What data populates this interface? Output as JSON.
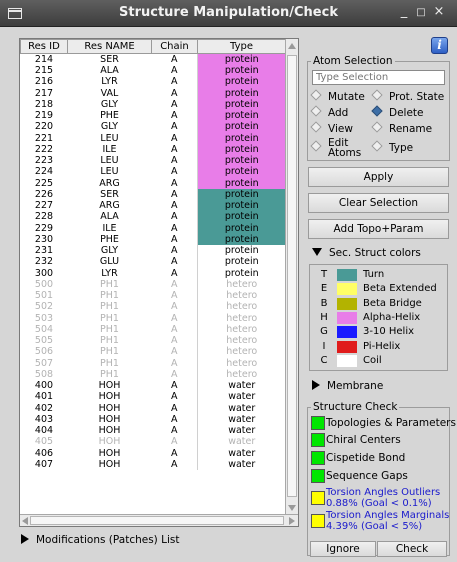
{
  "window": {
    "title": "Structure Manipulation/Check",
    "minimize_glyph": "_",
    "maximize_glyph": "□",
    "close_glyph": "×"
  },
  "table": {
    "columns": [
      "Res ID",
      "Res NAME",
      "Chain",
      "Type"
    ],
    "rows": [
      {
        "id": "214",
        "name": "SER",
        "chain": "A",
        "type": "protein",
        "color": "#e87de8"
      },
      {
        "id": "215",
        "name": "ALA",
        "chain": "A",
        "type": "protein",
        "color": "#e87de8"
      },
      {
        "id": "216",
        "name": "LYR",
        "chain": "A",
        "type": "protein",
        "color": "#e87de8"
      },
      {
        "id": "217",
        "name": "VAL",
        "chain": "A",
        "type": "protein",
        "color": "#e87de8"
      },
      {
        "id": "218",
        "name": "GLY",
        "chain": "A",
        "type": "protein",
        "color": "#e87de8"
      },
      {
        "id": "219",
        "name": "PHE",
        "chain": "A",
        "type": "protein",
        "color": "#e87de8"
      },
      {
        "id": "220",
        "name": "GLY",
        "chain": "A",
        "type": "protein",
        "color": "#e87de8"
      },
      {
        "id": "221",
        "name": "LEU",
        "chain": "A",
        "type": "protein",
        "color": "#e87de8"
      },
      {
        "id": "222",
        "name": "ILE",
        "chain": "A",
        "type": "protein",
        "color": "#e87de8"
      },
      {
        "id": "223",
        "name": "LEU",
        "chain": "A",
        "type": "protein",
        "color": "#e87de8"
      },
      {
        "id": "224",
        "name": "LEU",
        "chain": "A",
        "type": "protein",
        "color": "#e87de8"
      },
      {
        "id": "225",
        "name": "ARG",
        "chain": "A",
        "type": "protein",
        "color": "#e87de8"
      },
      {
        "id": "226",
        "name": "SER",
        "chain": "A",
        "type": "protein",
        "color": "#4a9a96"
      },
      {
        "id": "227",
        "name": "ARG",
        "chain": "A",
        "type": "protein",
        "color": "#4a9a96"
      },
      {
        "id": "228",
        "name": "ALA",
        "chain": "A",
        "type": "protein",
        "color": "#4a9a96"
      },
      {
        "id": "229",
        "name": "ILE",
        "chain": "A",
        "type": "protein",
        "color": "#4a9a96"
      },
      {
        "id": "230",
        "name": "PHE",
        "chain": "A",
        "type": "protein",
        "color": "#4a9a96"
      },
      {
        "id": "231",
        "name": "GLY",
        "chain": "A",
        "type": "protein",
        "color": "#ffffff"
      },
      {
        "id": "232",
        "name": "GLU",
        "chain": "A",
        "type": "protein",
        "color": "#ffffff"
      },
      {
        "id": "300",
        "name": "LYR",
        "chain": "A",
        "type": "protein",
        "color": "#ffffff"
      },
      {
        "id": "500",
        "name": "PH1",
        "chain": "A",
        "type": "hetero",
        "faded": true
      },
      {
        "id": "501",
        "name": "PH1",
        "chain": "A",
        "type": "hetero",
        "faded": true
      },
      {
        "id": "502",
        "name": "PH1",
        "chain": "A",
        "type": "hetero",
        "faded": true
      },
      {
        "id": "503",
        "name": "PH1",
        "chain": "A",
        "type": "hetero",
        "faded": true
      },
      {
        "id": "504",
        "name": "PH1",
        "chain": "A",
        "type": "hetero",
        "faded": true
      },
      {
        "id": "505",
        "name": "PH1",
        "chain": "A",
        "type": "hetero",
        "faded": true
      },
      {
        "id": "506",
        "name": "PH1",
        "chain": "A",
        "type": "hetero",
        "faded": true
      },
      {
        "id": "507",
        "name": "PH1",
        "chain": "A",
        "type": "hetero",
        "faded": true
      },
      {
        "id": "508",
        "name": "PH1",
        "chain": "A",
        "type": "hetero",
        "faded": true
      },
      {
        "id": "400",
        "name": "HOH",
        "chain": "A",
        "type": "water"
      },
      {
        "id": "401",
        "name": "HOH",
        "chain": "A",
        "type": "water"
      },
      {
        "id": "402",
        "name": "HOH",
        "chain": "A",
        "type": "water"
      },
      {
        "id": "403",
        "name": "HOH",
        "chain": "A",
        "type": "water"
      },
      {
        "id": "404",
        "name": "HOH",
        "chain": "A",
        "type": "water"
      },
      {
        "id": "405",
        "name": "HOH",
        "chain": "A",
        "type": "water",
        "faded": true
      },
      {
        "id": "406",
        "name": "HOH",
        "chain": "A",
        "type": "water"
      },
      {
        "id": "407",
        "name": "HOH",
        "chain": "A",
        "type": "water"
      }
    ]
  },
  "modifications_label": "Modifications (Patches) List",
  "atom_selection": {
    "legend": "Atom Selection",
    "placeholder": "Type Selection",
    "options": [
      {
        "label": "Mutate",
        "selected": false
      },
      {
        "label": "Prot. State",
        "selected": false
      },
      {
        "label": "Add",
        "selected": false
      },
      {
        "label": "Delete",
        "selected": true
      },
      {
        "label": "View",
        "selected": false
      },
      {
        "label": "Rename",
        "selected": false
      },
      {
        "label": "Edit",
        "label2": "Atoms",
        "selected": false
      },
      {
        "label": "Type",
        "selected": false
      }
    ]
  },
  "buttons": {
    "apply": "Apply",
    "clear": "Clear Selection",
    "topo": "Add Topo+Param",
    "ignore": "Ignore",
    "check": "Check"
  },
  "sec_struct": {
    "label": "Sec. Struct colors",
    "items": [
      {
        "code": "T",
        "name": "Turn",
        "color": "#4a9a96"
      },
      {
        "code": "E",
        "name": "Beta Extended",
        "color": "#ffff66"
      },
      {
        "code": "B",
        "name": "Beta Bridge",
        "color": "#b3b300"
      },
      {
        "code": "H",
        "name": "Alpha-Helix",
        "color": "#e87de8"
      },
      {
        "code": "G",
        "name": "3-10 Helix",
        "color": "#1a1aff"
      },
      {
        "code": "I",
        "name": "Pi-Helix",
        "color": "#e01b1b"
      },
      {
        "code": "C",
        "name": "Coil",
        "color": "#ffffff"
      }
    ]
  },
  "membrane_label": "Membrane",
  "structure_check": {
    "legend": "Structure Check",
    "items": [
      {
        "label": "Topologies & Parameters",
        "status_color": "#00e600"
      },
      {
        "label": "Chiral Centers",
        "status_color": "#00e600"
      },
      {
        "label": "Cispetide Bond",
        "status_color": "#00e600"
      },
      {
        "label": "Sequence Gaps",
        "status_color": "#00e600"
      },
      {
        "label": "Torsion Angles Outliers",
        "label2": "0.88% (Goal < 0.1%)",
        "status_color": "#ffff00",
        "warn": true
      },
      {
        "label": "Torsion Angles Marginals",
        "label2": "4.39% (Goal < 5%)",
        "status_color": "#ffff00",
        "warn": true
      }
    ]
  }
}
